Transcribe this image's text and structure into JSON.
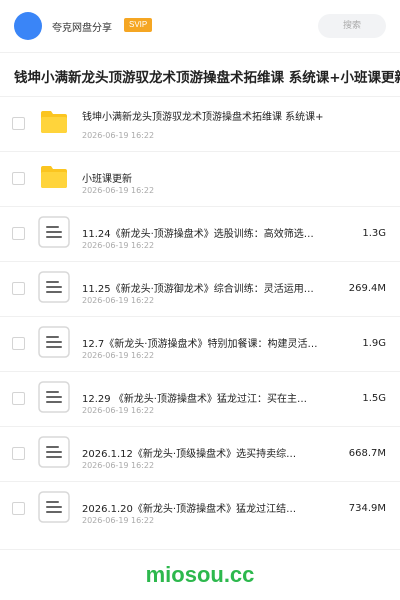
{
  "header": {
    "sharer_name": "夸克网盘分享",
    "badge": "SVIP",
    "search_placeholder": "搜索"
  },
  "page_title": "钱坤小满新龙头顶游驭龙术顶游操盘术拓维课 系统课+小班课更新",
  "files": [
    {
      "type": "folder",
      "name": "钱坤小满新龙头顶游驭龙术顶游操盘术拓维课 系统课+",
      "date": "2026-06-19 16:22",
      "size": ""
    },
    {
      "type": "folder",
      "name": "小班课更新",
      "date": "2026-06-19 16:22",
      "size": ""
    },
    {
      "type": "file",
      "name": "11.24《新龙头·顶游操盘术》选股训练：高效筛选…",
      "date": "2026-06-19 16:22",
      "size": "1.3G"
    },
    {
      "type": "file",
      "name": "11.25《新龙头·顶游御龙术》综合训练：灵活运用…",
      "date": "2026-06-19 16:22",
      "size": "269.4M"
    },
    {
      "type": "file",
      "name": "12.7《新龙头·顶游操盘术》特别加餐课：构建灵活…",
      "date": "2026-06-19 16:22",
      "size": "1.9G"
    },
    {
      "type": "file",
      "name": "12.29 《新龙头·顶游操盘术》猛龙过江：买在主…",
      "date": "2026-06-19 16:22",
      "size": "1.5G"
    },
    {
      "type": "file",
      "name": "2026.1.12《新龙头·顶级操盘术》选买持卖综…",
      "date": "2026-06-19 16:22",
      "size": "668.7M"
    },
    {
      "type": "file",
      "name": "2026.1.20《新龙头·顶游操盘术》猛龙过江结…",
      "date": "2026-06-19 16:22",
      "size": "734.9M"
    }
  ],
  "footer": {
    "brand": "miosou.cc"
  },
  "colors": {
    "avatar": "#3a85f7",
    "badge": "#f5a623",
    "folder": "#fbc520",
    "brand": "#2db84d"
  },
  "icons": {
    "folder": "folder-icon",
    "file": "document-icon"
  }
}
